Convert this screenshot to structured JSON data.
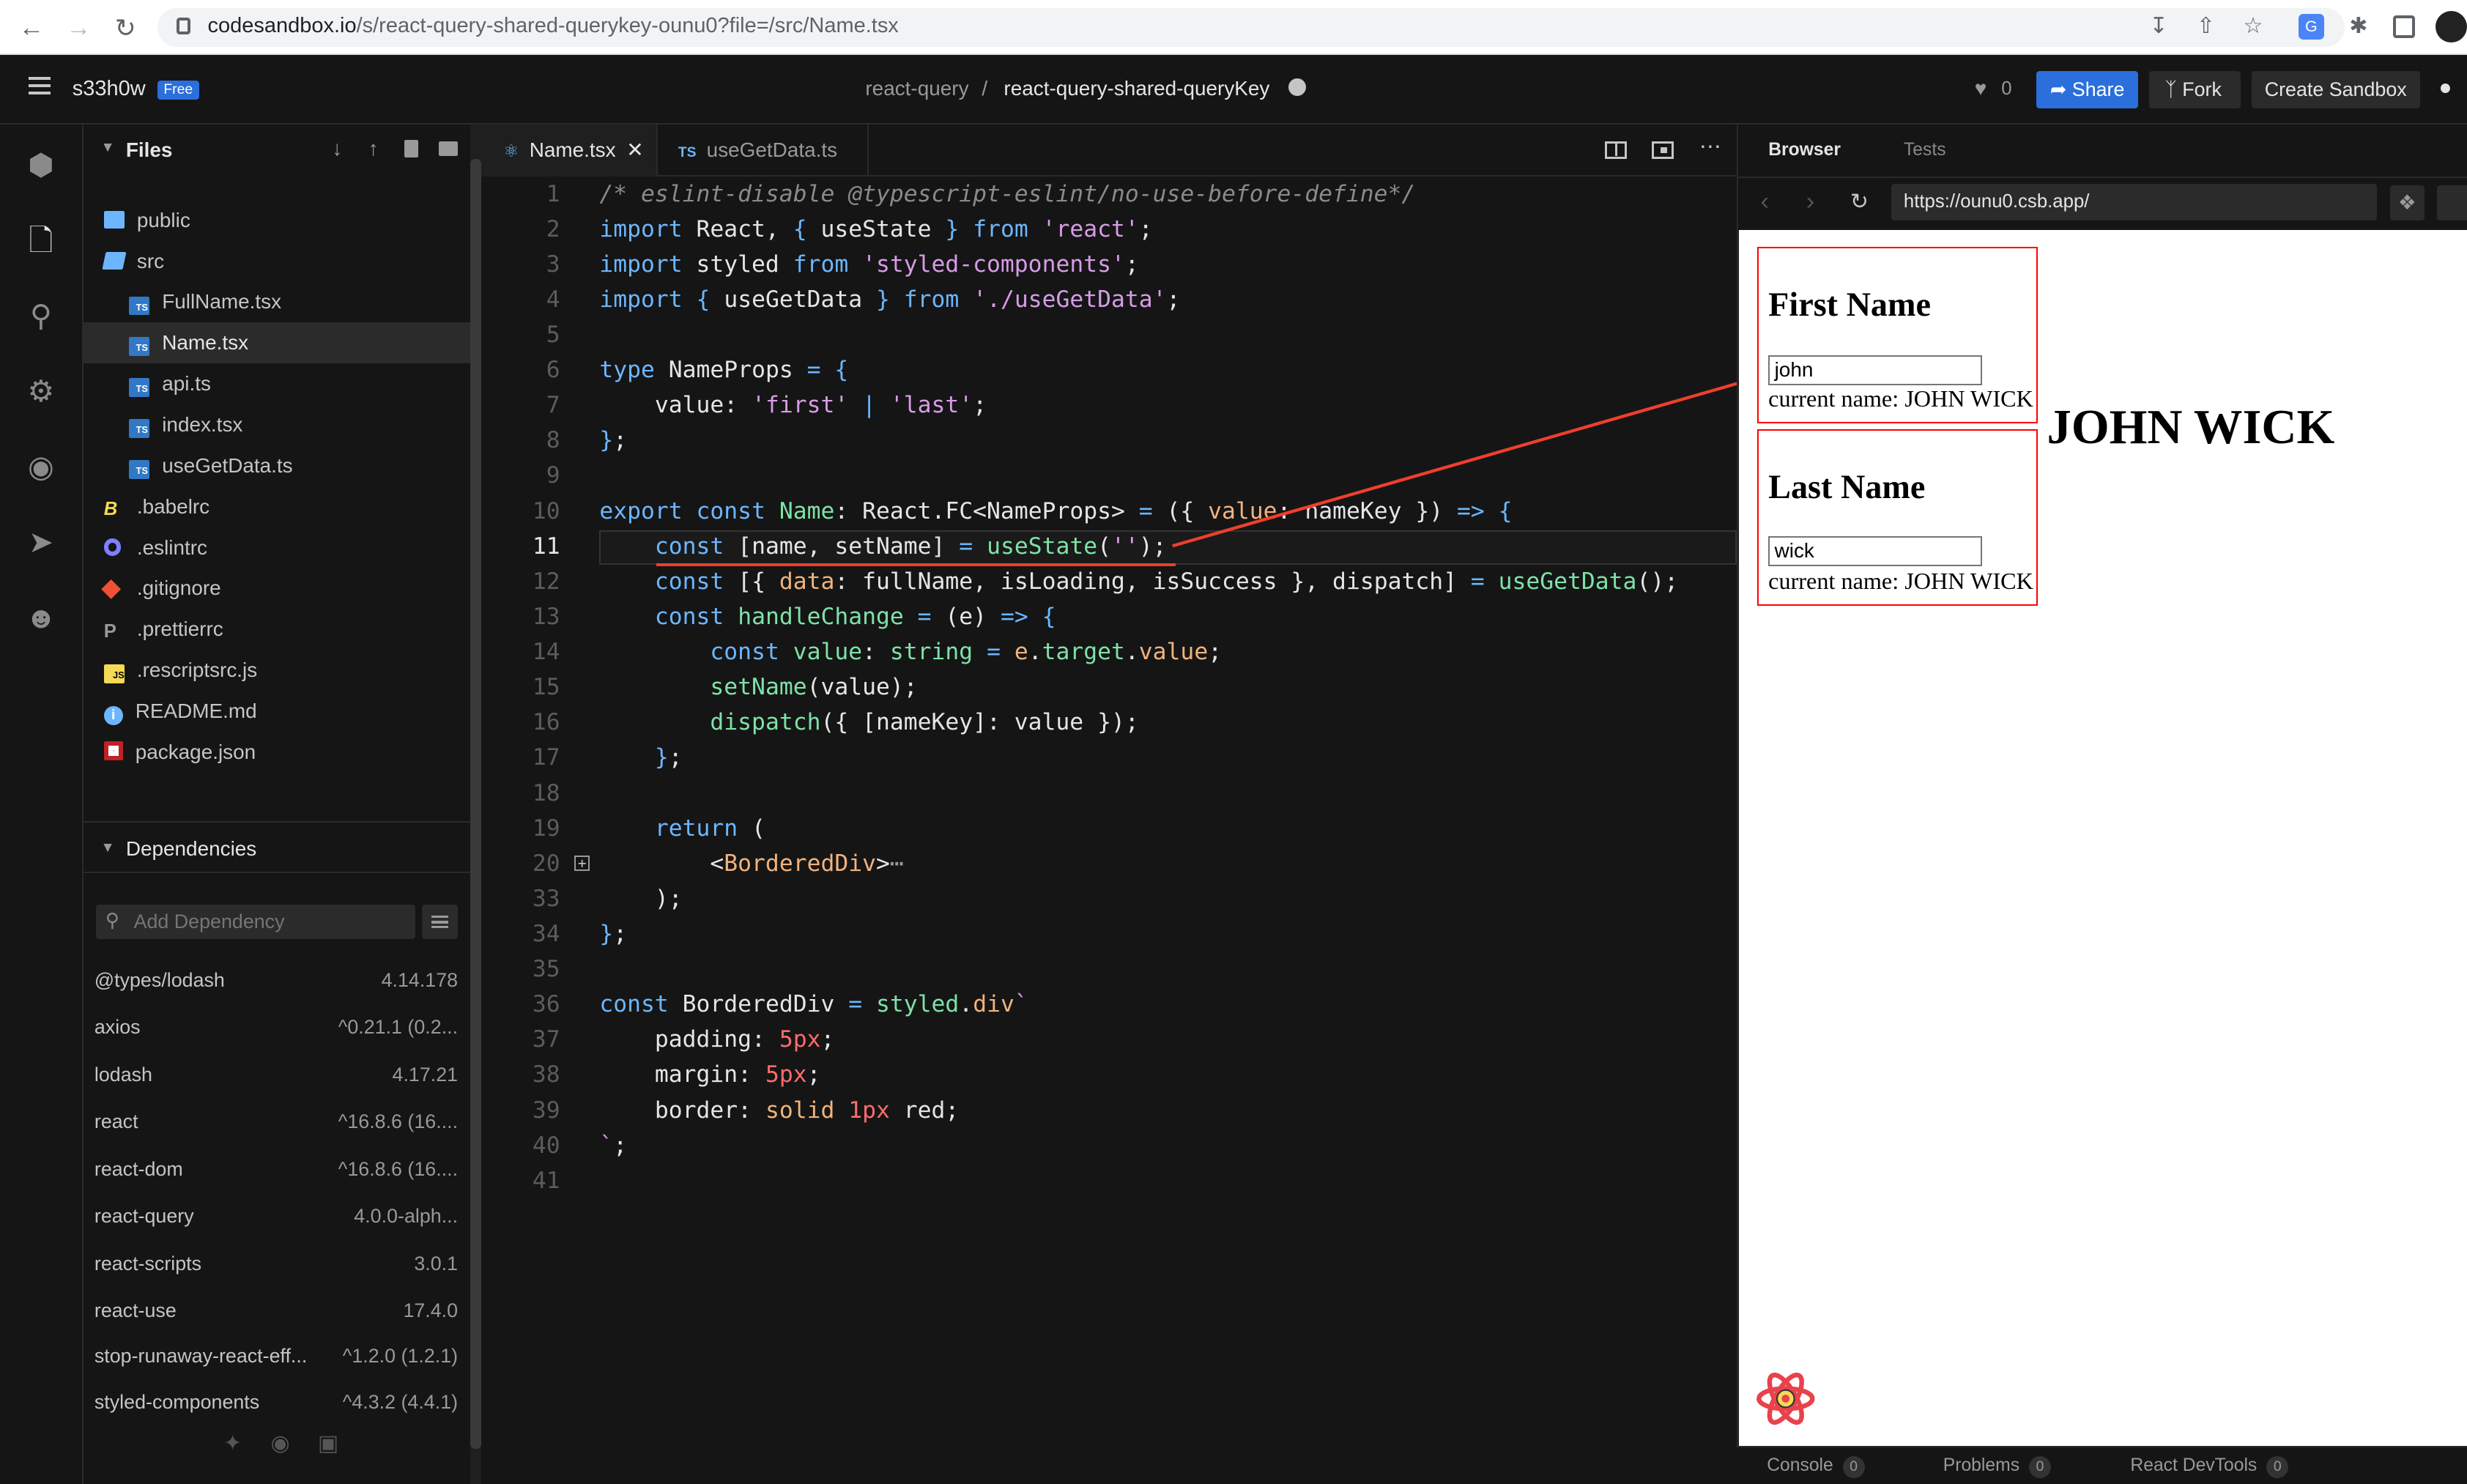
{
  "chrome": {
    "url_domain": "codesandbox.io",
    "url_path": "/s/react-query-shared-querykey-ounu0?file=/src/Name.tsx"
  },
  "header": {
    "user": "s33h0w",
    "plan_badge": "Free",
    "breadcrumb_parent": "react-query",
    "breadcrumb_sep": "/",
    "sandbox_name": "react-query-shared-queryKey",
    "likes": "0",
    "share_label": "Share",
    "fork_label": "Fork",
    "create_label": "Create Sandbox"
  },
  "files": {
    "title": "Files",
    "items": [
      {
        "name": "public",
        "kind": "folder"
      },
      {
        "name": "src",
        "kind": "folder-open"
      },
      {
        "name": "FullName.tsx",
        "kind": "ts"
      },
      {
        "name": "Name.tsx",
        "kind": "ts"
      },
      {
        "name": "api.ts",
        "kind": "ts"
      },
      {
        "name": "index.tsx",
        "kind": "ts"
      },
      {
        "name": "useGetData.ts",
        "kind": "ts"
      },
      {
        "name": ".babelrc",
        "kind": "babel"
      },
      {
        "name": ".eslintrc",
        "kind": "eslint"
      },
      {
        "name": ".gitignore",
        "kind": "git"
      },
      {
        "name": ".prettierrc",
        "kind": "prettier"
      },
      {
        "name": ".rescriptsrc.js",
        "kind": "js"
      },
      {
        "name": "README.md",
        "kind": "info"
      },
      {
        "name": "package.json",
        "kind": "npm"
      }
    ]
  },
  "dependencies": {
    "title": "Dependencies",
    "search_placeholder": "Add Dependency",
    "items": [
      {
        "name": "@types/lodash",
        "version": "4.14.178"
      },
      {
        "name": "axios",
        "version": "^0.21.1 (0.2..."
      },
      {
        "name": "lodash",
        "version": "4.17.21"
      },
      {
        "name": "react",
        "version": "^16.8.6 (16...."
      },
      {
        "name": "react-dom",
        "version": "^16.8.6 (16...."
      },
      {
        "name": "react-query",
        "version": "4.0.0-alph..."
      },
      {
        "name": "react-scripts",
        "version": "3.0.1"
      },
      {
        "name": "react-use",
        "version": "17.4.0"
      },
      {
        "name": "stop-runaway-react-eff...",
        "version": "^1.2.0 (1.2.1)"
      },
      {
        "name": "styled-components",
        "version": "^4.3.2 (4.4.1)"
      }
    ]
  },
  "editor": {
    "tabs": [
      {
        "label": "Name.tsx",
        "badge": ""
      },
      {
        "label": "useGetData.ts",
        "badge": "TS"
      }
    ],
    "line_numbers": [
      "1",
      "2",
      "3",
      "4",
      "5",
      "6",
      "7",
      "8",
      "9",
      "10",
      "11",
      "12",
      "13",
      "14",
      "15",
      "16",
      "17",
      "18",
      "19",
      "20",
      "33",
      "34",
      "35",
      "36",
      "37",
      "38",
      "39",
      "40",
      "41"
    ]
  },
  "browser": {
    "tab_browser": "Browser",
    "tab_tests": "Tests",
    "address": "https://ounu0.csb.app/",
    "first_heading": "First Name",
    "first_value": "john",
    "first_current": "current name: JOHN WICK",
    "last_heading": "Last Name",
    "last_value": "wick",
    "last_current": "current name: JOHN WICK",
    "full_name": "JOHN WICK",
    "bottom": [
      {
        "label": "Console",
        "count": "0"
      },
      {
        "label": "Problems",
        "count": "0"
      },
      {
        "label": "React DevTools",
        "count": "0"
      }
    ]
  },
  "colors": {
    "accent_blue": "#2a6fdb",
    "annotation_red": "#ee3f2c"
  }
}
